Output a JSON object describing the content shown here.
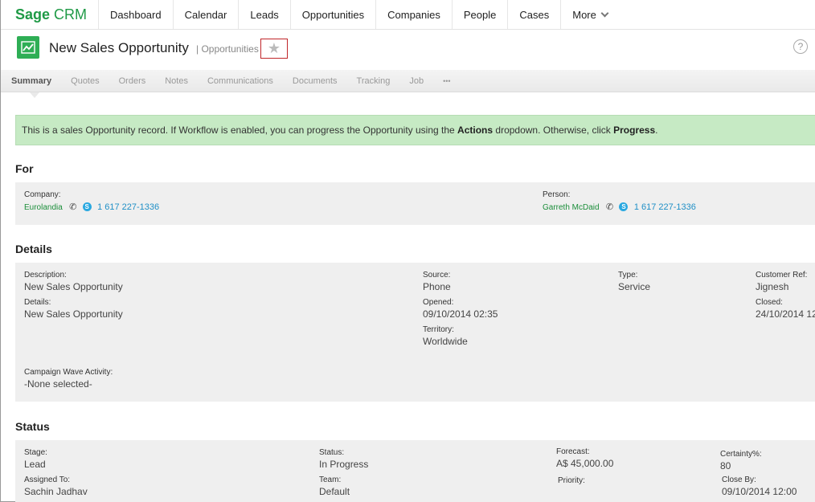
{
  "app": {
    "logo_main": "Sage",
    "logo_sub": "CRM"
  },
  "nav": {
    "items": [
      "Dashboard",
      "Calendar",
      "Leads",
      "Opportunities",
      "Companies",
      "People",
      "Cases"
    ],
    "more": "More"
  },
  "header": {
    "title": "New Sales Opportunity",
    "entity": "| Opportunities",
    "favorite_glyph": "★",
    "help_glyph": "?"
  },
  "tabs": [
    "Summary",
    "Quotes",
    "Orders",
    "Notes",
    "Communications",
    "Documents",
    "Tracking",
    "Job",
    "•••"
  ],
  "banner": {
    "prefix": "This is a sales Opportunity record. If Workflow is enabled, you can progress the Opportunity using the ",
    "actions": "Actions",
    "middle": " dropdown. Otherwise, click ",
    "progress": "Progress",
    "suffix": "."
  },
  "for_section": {
    "title": "For",
    "company_label": "Company:",
    "company_value": "Eurolandia",
    "company_phone": "1 617 227-1336",
    "person_label": "Person:",
    "person_value": "Garreth McDaid",
    "person_phone": "1 617 227-1336"
  },
  "details_section": {
    "title": "Details",
    "description_label": "Description:",
    "description_value": "New Sales Opportunity",
    "details_label": "Details:",
    "details_value": "New Sales Opportunity",
    "source_label": "Source:",
    "source_value": "Phone",
    "opened_label": "Opened:",
    "opened_value": "09/10/2014 02:35",
    "territory_label": "Territory:",
    "territory_value": "Worldwide",
    "type_label": "Type:",
    "type_value": "Service",
    "customer_ref_label": "Customer Ref:",
    "customer_ref_value": "Jignesh",
    "closed_label": "Closed:",
    "closed_value": "24/10/2014 12",
    "campaign_label": "Campaign Wave Activity:",
    "campaign_value": "-None selected-"
  },
  "status_section": {
    "title": "Status",
    "stage_label": "Stage:",
    "stage_value": "Lead",
    "assigned_label": "Assigned To:",
    "assigned_value": "Sachin Jadhav",
    "status_label": "Status:",
    "status_value": "In Progress",
    "team_label": "Team:",
    "team_value": "Default",
    "forecast_label": "Forecast:",
    "forecast_value": "A$ 45,000.00",
    "priority_label": "Priority:",
    "certainty_label": "Certainty%:",
    "certainty_value": "80",
    "close_by_label": "Close By:",
    "close_by_value": "09/10/2014 12:00"
  }
}
